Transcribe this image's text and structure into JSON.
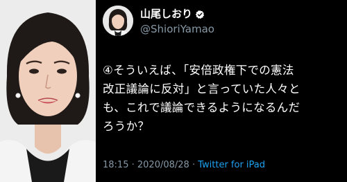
{
  "user": {
    "display_name": "山尾しおり",
    "handle": "@ShioriYamao",
    "verified_icon": "verified-badge-icon"
  },
  "tweet": {
    "text": "④そういえば、「安倍政権下での憲法\n改正議論に反対」と言っていた人々と\nも、これで議論できるようになるんだ\nろうか？",
    "time": "18:15",
    "separator": " · ",
    "date": "2020/08/28",
    "client": "Twitter for iPad"
  },
  "colors": {
    "background": "#000000",
    "text": "#ffffff",
    "secondary": "#8899a6",
    "accent": "#1da1f2"
  }
}
